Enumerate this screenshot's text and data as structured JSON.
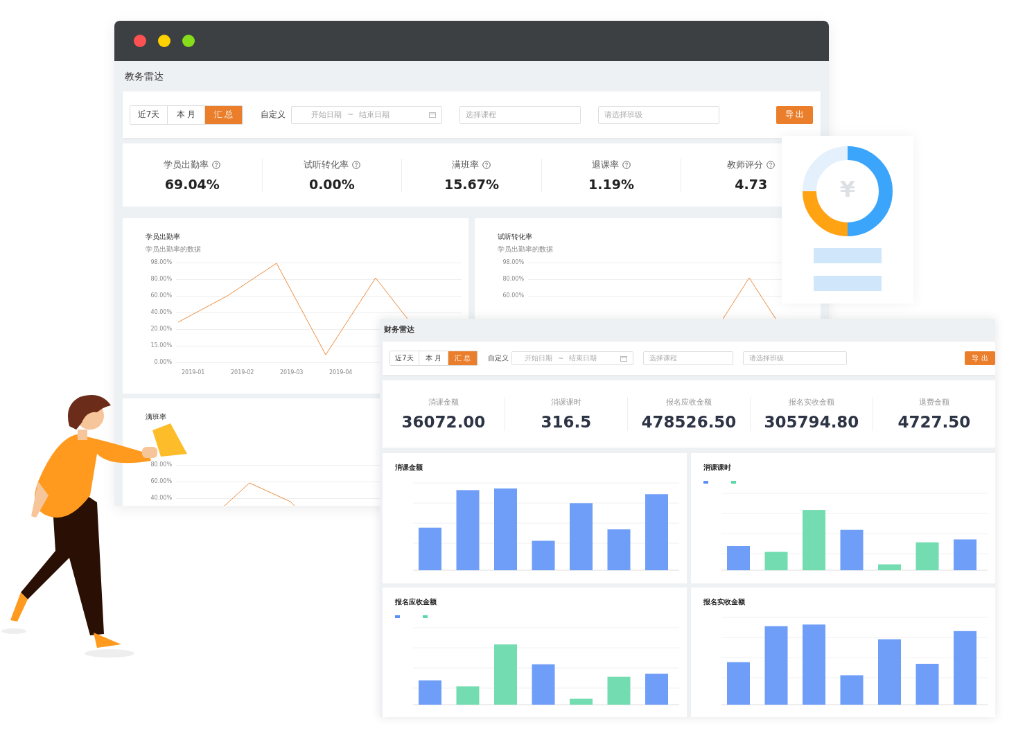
{
  "education_window": {
    "title": "教务雷达",
    "filters": {
      "ranges": [
        {
          "label": "近7天",
          "selected": false
        },
        {
          "label": "本 月",
          "selected": false
        },
        {
          "label": "汇 总",
          "selected": true
        }
      ],
      "custom_label": "自定义",
      "start_placeholder": "开始日期",
      "separator": "~",
      "end_placeholder": "结束日期",
      "course_placeholder": "选择课程",
      "class_placeholder": "请选择班级",
      "export_label": "导 出"
    },
    "stats": [
      {
        "label": "学员出勤率",
        "value": "69.04%"
      },
      {
        "label": "试听转化率",
        "value": "0.00%"
      },
      {
        "label": "满班率",
        "value": "15.67%"
      },
      {
        "label": "退课率",
        "value": "1.19%"
      },
      {
        "label": "教师评分",
        "value": "4.73"
      }
    ],
    "charts": [
      {
        "title": "学员出勤率",
        "subtitle": "学员出勤率的数据",
        "y_ticks": [
          "98.00%",
          "80.00%",
          "60.00%",
          "40.00%",
          "20.00%",
          "15.00%",
          "0.00%"
        ],
        "x_ticks": [
          "2019-01",
          "2019-02",
          "2019-03",
          "2019-04"
        ]
      },
      {
        "title": "试听转化率",
        "subtitle": "学员出勤率的数据",
        "y_ticks": [
          "98.00%",
          "80.00%",
          "60.00%"
        ]
      },
      {
        "title": "满班率",
        "y_ticks": [
          "80.00%",
          "60.00%",
          "40.00%"
        ]
      }
    ]
  },
  "coin_card": {
    "symbol": "¥"
  },
  "finance_panel": {
    "title": "财务雷达",
    "filters": {
      "ranges": [
        {
          "label": "近7天",
          "selected": false
        },
        {
          "label": "本 月",
          "selected": false
        },
        {
          "label": "汇 总",
          "selected": true
        }
      ],
      "custom_label": "自定义",
      "start_placeholder": "开始日期",
      "separator": "~",
      "end_placeholder": "结束日期",
      "course_placeholder": "选择课程",
      "class_placeholder": "请选择班级",
      "export_label": "导 出"
    },
    "stats": [
      {
        "label": "消课金额",
        "value": "36072.00"
      },
      {
        "label": "消课课时",
        "value": "316.5"
      },
      {
        "label": "报名应收金额",
        "value": "478526.50"
      },
      {
        "label": "报名实收金额",
        "value": "305794.80"
      },
      {
        "label": "退费金额",
        "value": "4727.50"
      }
    ],
    "charts": [
      {
        "title": "消课金额"
      },
      {
        "title": "消课课时"
      },
      {
        "title": "报名应收金额"
      },
      {
        "title": "报名实收金额"
      }
    ]
  }
}
